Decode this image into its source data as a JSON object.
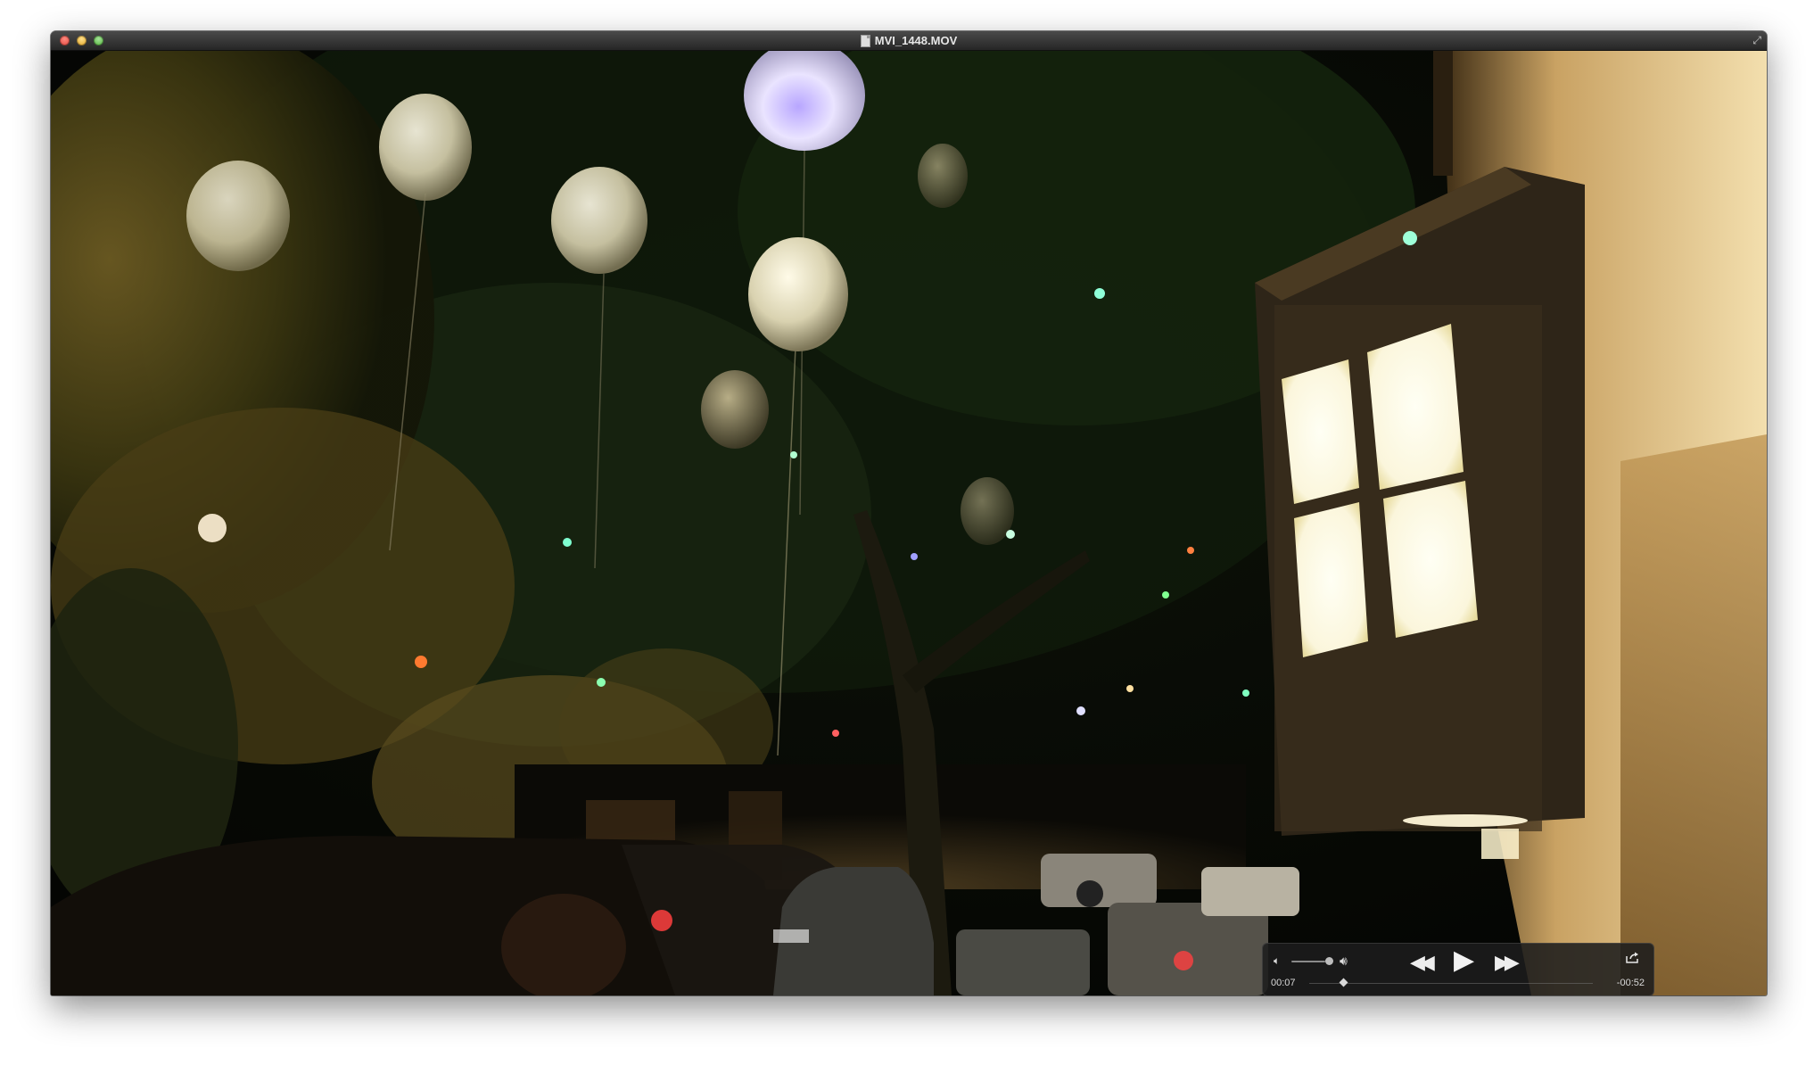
{
  "window": {
    "title": "MVI_1448.MOV"
  },
  "titlebar": {
    "buttons": [
      "close-icon",
      "minimize-icon",
      "zoom-icon"
    ],
    "file_icon": "document-icon",
    "fullscreen_icon": "fullscreen-icon"
  },
  "controls": {
    "volume_low_icon": "speaker-low-icon",
    "volume_high_icon": "speaker-high-icon",
    "volume_level": 0.95,
    "rewind_icon": "rewind-icon",
    "play_icon": "play-icon",
    "fast_forward_icon": "fast-forward-icon",
    "share_icon": "share-icon",
    "elapsed": "00:07",
    "remaining": "-00:52",
    "playhead_fraction": 0.12
  }
}
